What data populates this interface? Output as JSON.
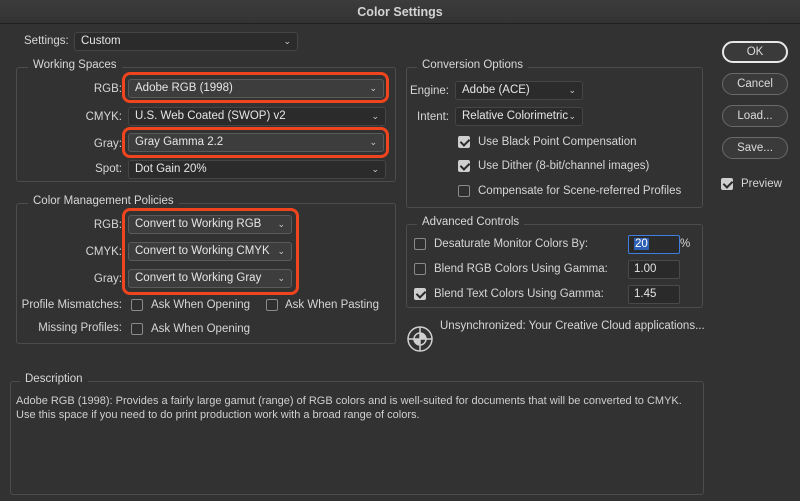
{
  "window": {
    "title": "Color Settings"
  },
  "settings": {
    "label": "Settings:",
    "value": "Custom"
  },
  "working_spaces": {
    "title": "Working Spaces",
    "rgb": {
      "label": "RGB:",
      "value": "Adobe RGB (1998)"
    },
    "cmyk": {
      "label": "CMYK:",
      "value": "U.S. Web Coated (SWOP) v2"
    },
    "gray": {
      "label": "Gray:",
      "value": "Gray Gamma 2.2"
    },
    "spot": {
      "label": "Spot:",
      "value": "Dot Gain 20%"
    }
  },
  "policies": {
    "title": "Color Management Policies",
    "rgb": {
      "label": "RGB:",
      "value": "Convert to Working RGB"
    },
    "cmyk": {
      "label": "CMYK:",
      "value": "Convert to Working CMYK"
    },
    "gray": {
      "label": "Gray:",
      "value": "Convert to Working Gray"
    },
    "mismatches": {
      "label": "Profile Mismatches:",
      "opening": "Ask When Opening",
      "pasting": "Ask When Pasting",
      "opening_checked": false,
      "pasting_checked": false
    },
    "missing": {
      "label": "Missing Profiles:",
      "opening": "Ask When Opening",
      "opening_checked": false
    }
  },
  "conversion": {
    "title": "Conversion Options",
    "engine": {
      "label": "Engine:",
      "value": "Adobe (ACE)"
    },
    "intent": {
      "label": "Intent:",
      "value": "Relative Colorimetric"
    },
    "black_point": {
      "label": "Use Black Point Compensation",
      "checked": true
    },
    "dither": {
      "label": "Use Dither (8-bit/channel images)",
      "checked": true
    },
    "scene": {
      "label": "Compensate for Scene-referred Profiles",
      "checked": false
    }
  },
  "advanced": {
    "title": "Advanced Controls",
    "desaturate": {
      "label": "Desaturate Monitor Colors By:",
      "value": "20",
      "unit": "%",
      "checked": false
    },
    "blend_rgb": {
      "label": "Blend RGB Colors Using Gamma:",
      "value": "1.00",
      "checked": false
    },
    "blend_text": {
      "label": "Blend Text Colors Using Gamma:",
      "value": "1.45",
      "checked": true
    }
  },
  "sync": {
    "icon": "sync-status-icon",
    "text": "Unsynchronized: Your Creative Cloud applications..."
  },
  "description": {
    "title": "Description",
    "line1": "Adobe RGB (1998):  Provides a fairly large gamut (range) of RGB colors and is well-suited for documents that will be converted to CMYK.",
    "line2": "Use this space if you need to do print production work with a broad range of colors."
  },
  "buttons": {
    "ok": "OK",
    "cancel": "Cancel",
    "load": "Load...",
    "save": "Save..."
  },
  "preview": {
    "label": "Preview",
    "checked": true
  },
  "colors": {
    "highlight": "#f0441e",
    "background": "#323232"
  }
}
